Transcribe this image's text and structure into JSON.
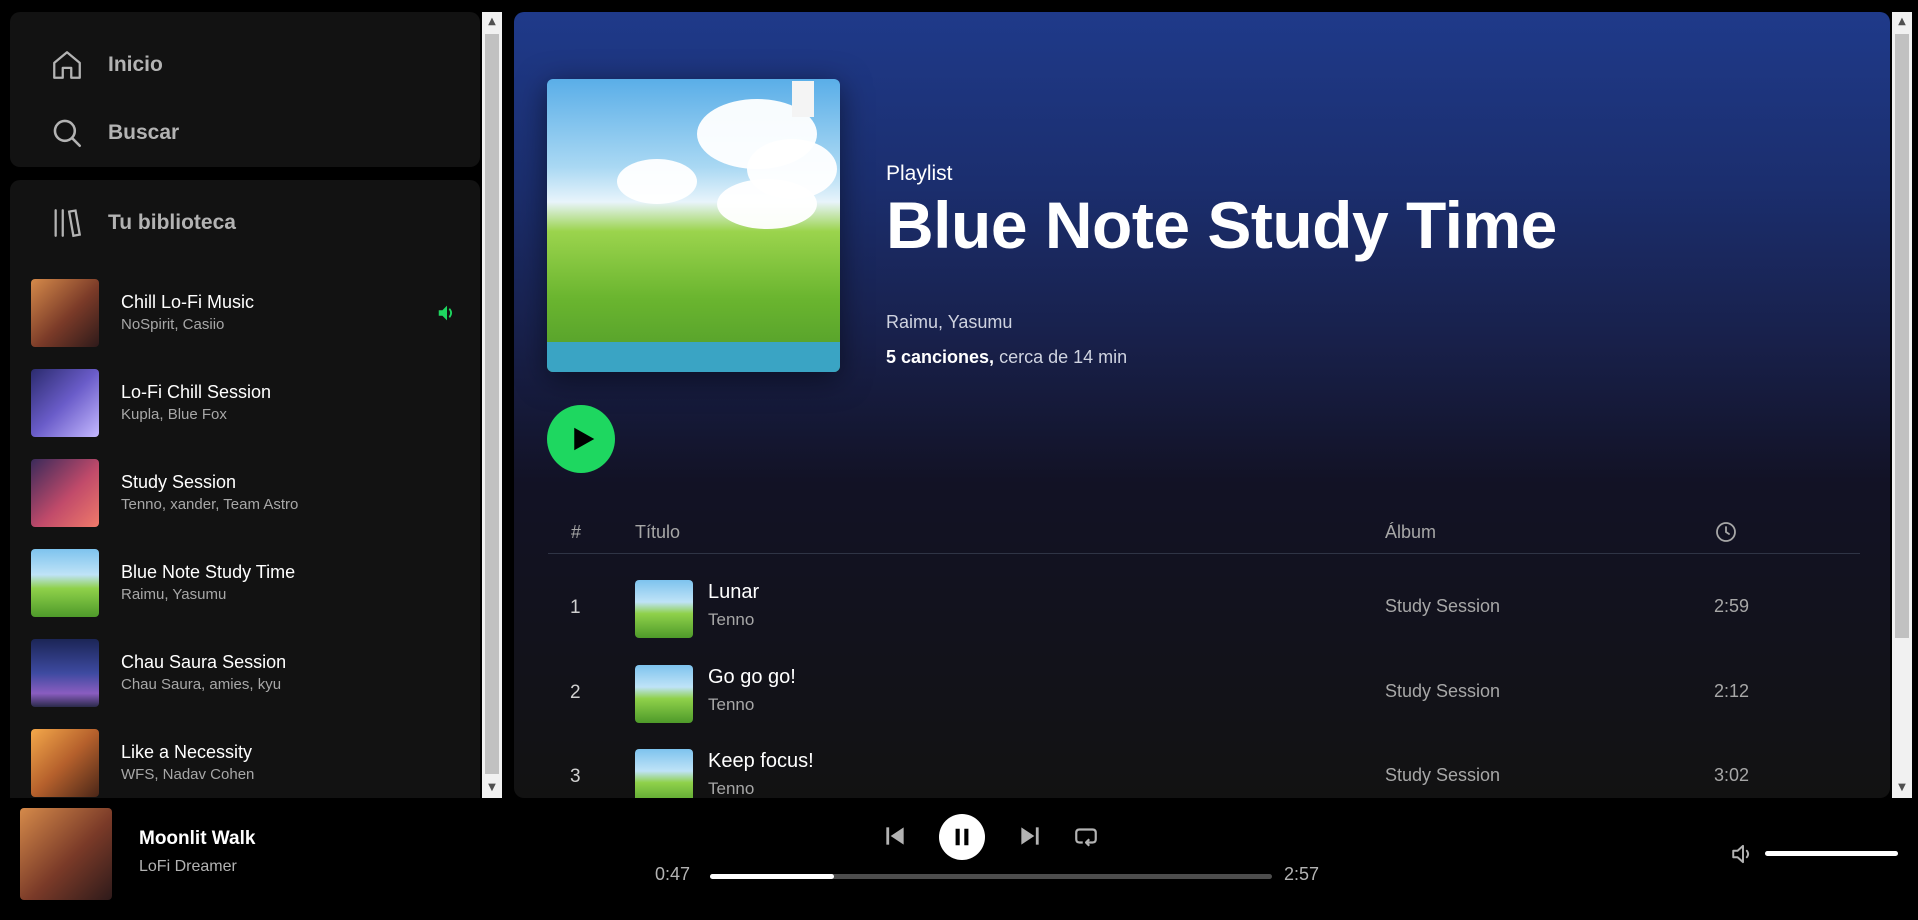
{
  "nav": {
    "home_label": "Inicio",
    "search_label": "Buscar"
  },
  "library": {
    "title": "Tu biblioteca",
    "items": [
      {
        "title": "Chill Lo-Fi Music",
        "subtitle": "NoSpirit, Casiio",
        "playing": true
      },
      {
        "title": "Lo-Fi Chill Session",
        "subtitle": "Kupla, Blue Fox"
      },
      {
        "title": "Study Session",
        "subtitle": "Tenno, xander, Team Astro"
      },
      {
        "title": "Blue Note Study Time",
        "subtitle": "Raimu, Yasumu"
      },
      {
        "title": "Chau Saura Session",
        "subtitle": "Chau Saura, amies, kyu"
      },
      {
        "title": "Like a Necessity",
        "subtitle": "WFS, Nadav Cohen"
      }
    ]
  },
  "playlist": {
    "type": "Playlist",
    "title": "Blue Note Study Time",
    "artists": "Raimu, Yasumu",
    "song_count": "5 canciones,",
    "duration": "cerca de 14 min"
  },
  "table": {
    "col_number": "#",
    "col_title": "Título",
    "col_album": "Álbum",
    "rows": [
      {
        "number": "1",
        "title": "Lunar",
        "artist": "Tenno",
        "album": "Study Session",
        "duration": "2:59"
      },
      {
        "number": "2",
        "title": "Go go go!",
        "artist": "Tenno",
        "album": "Study Session",
        "duration": "2:12"
      },
      {
        "number": "3",
        "title": "Keep focus!",
        "artist": "Tenno",
        "album": "Study Session",
        "duration": "3:02"
      }
    ]
  },
  "player": {
    "track_title": "Moonlit Walk",
    "track_artist": "LoFi Dreamer",
    "current_time": "0:47",
    "total_time": "2:57",
    "progress_fraction": 0.22,
    "volume_fraction": 1.0
  },
  "colors": {
    "accent": "#1ed760",
    "sidebar_bg": "#121212",
    "header_gradient_top": "#1f3a8a"
  },
  "icons": [
    "home-icon",
    "search-icon",
    "library-icon",
    "speaker-playing-icon",
    "play-icon",
    "clock-icon",
    "previous-icon",
    "pause-icon",
    "next-icon",
    "repeat-icon",
    "volume-icon"
  ]
}
